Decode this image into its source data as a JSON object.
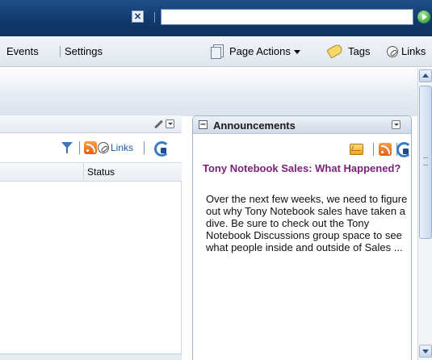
{
  "topbar": {
    "search_value": "",
    "search_placeholder": ""
  },
  "navbar": {
    "items": [
      {
        "label": "Events"
      },
      {
        "label": "Settings"
      }
    ],
    "page_actions_label": "Page Actions",
    "tags_label": "Tags",
    "links_label": "Links"
  },
  "left_portlet": {
    "links_label": "Links",
    "status_column": "Status"
  },
  "announcements": {
    "title": "Announcements",
    "collapse_symbol": "−",
    "item_heading": "Tony Notebook Sales: What Happened?",
    "item_body": "Over the next few weeks, we need to figure out why Tony Notebook sales have taken a dive. Be sure to check out the Tony Notebook Discussions group space to see what people inside and outside of Sales ..."
  },
  "colors": {
    "topbar": "#11386b",
    "announcement_heading": "#7b1f7a",
    "link": "#1f57a8"
  },
  "icons": [
    "close-icon",
    "go-icon",
    "page-actions-icon",
    "tag-icon",
    "links-icon",
    "edit-icon",
    "minimize-icon",
    "filter-icon",
    "rss-icon",
    "refresh-icon",
    "new-announcement-icon"
  ]
}
